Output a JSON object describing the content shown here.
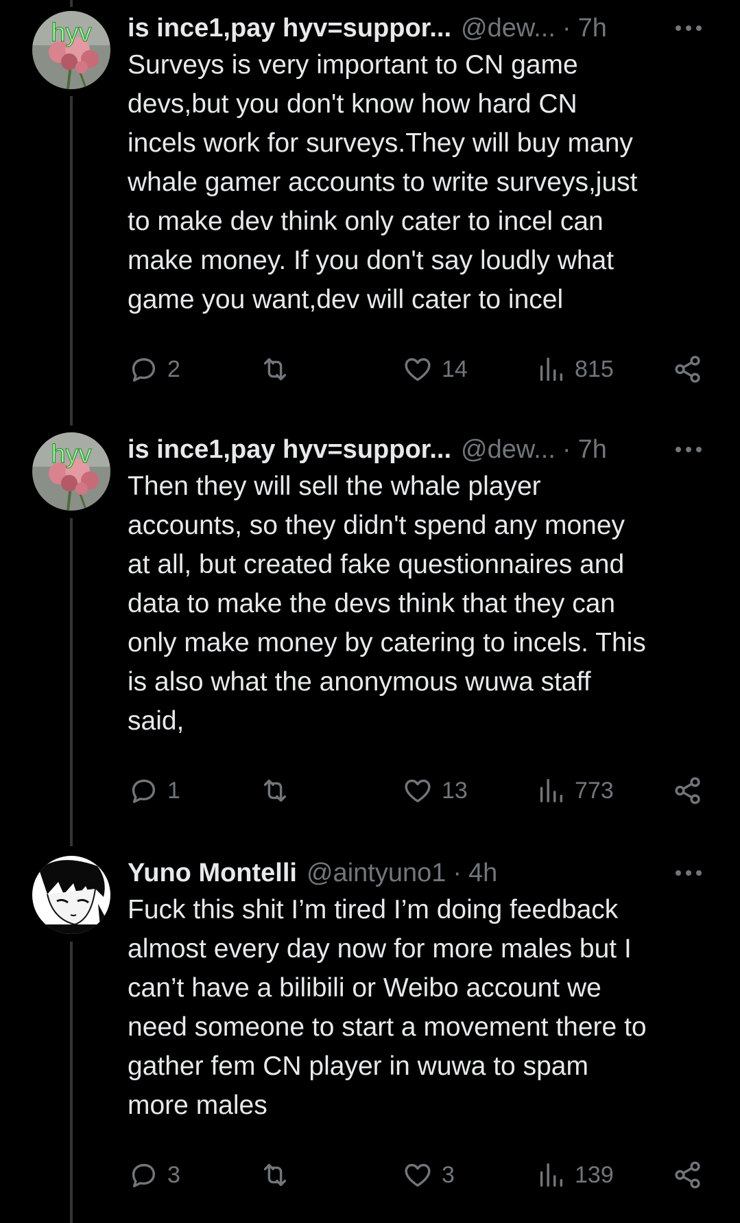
{
  "tweets": [
    {
      "display_name": "is ince1,pay hyv=suppor...",
      "handle": "@dew...",
      "time": "7h",
      "avatar_text": "hyv",
      "text": "Surveys is very important to CN game\ndevs,but you don't know how hard CN\nincels work for surveys.They will buy many\nwhale gamer accounts to write surveys,just\nto make dev think only cater to incel can\nmake money. If you don't say loudly what\ngame you want,dev will cater to incel",
      "replies": "2",
      "reposts": "",
      "likes": "14",
      "views": "815"
    },
    {
      "display_name": "is ince1,pay hyv=suppor...",
      "handle": "@dew...",
      "time": "7h",
      "avatar_text": "hyv",
      "text": "Then they will sell the whale player\naccounts, so they didn't spend any money\nat all, but created fake questionnaires and\ndata to make the devs think that they can\nonly make money by catering to incels. This\nis also what the anonymous wuwa staff\nsaid,",
      "replies": "1",
      "reposts": "",
      "likes": "13",
      "views": "773"
    },
    {
      "display_name": "Yuno Montelli",
      "handle": "@aintyuno1",
      "time": "4h",
      "avatar_text": "",
      "text": "Fuck this shit I’m tired I’m doing feedback\nalmost every day now for more males but I\ncan’t have a bilibili or Weibo account we\nneed someone to start a movement there to\ngather fem CN player in wuwa to spam\nmore males",
      "replies": "3",
      "reposts": "",
      "likes": "3",
      "views": "139"
    }
  ],
  "separator": "·",
  "colors": {
    "background": "#000000",
    "text": "#e7e9ea",
    "muted": "#71767b",
    "thread_line": "#333639",
    "avatar_text": "#9dff9d"
  },
  "icons": [
    "reply-icon",
    "repost-icon",
    "like-icon",
    "views-icon",
    "share-icon",
    "more-icon"
  ]
}
